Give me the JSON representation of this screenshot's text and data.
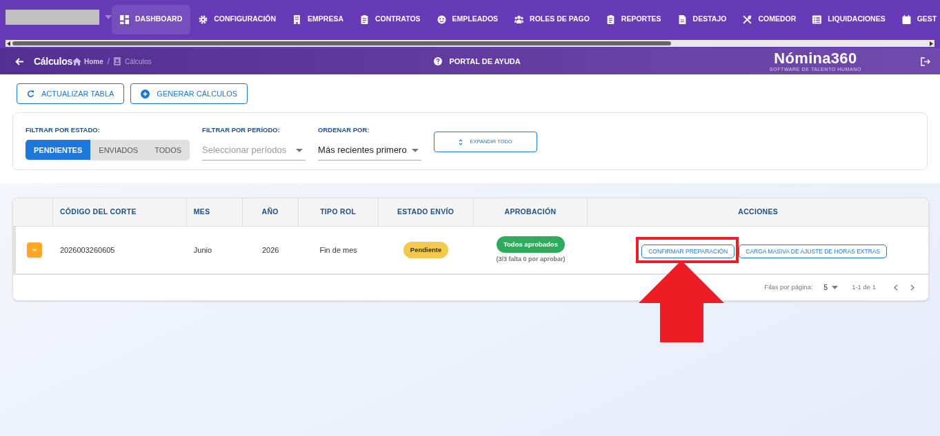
{
  "nav": {
    "items": [
      {
        "label": "DASHBOARD",
        "selected": true
      },
      {
        "label": "CONFIGURACIÓN",
        "selected": false
      },
      {
        "label": "EMPRESA",
        "selected": false
      },
      {
        "label": "CONTRATOS",
        "selected": false
      },
      {
        "label": "EMPLEADOS",
        "selected": false
      },
      {
        "label": "ROLES DE PAGO",
        "selected": false
      },
      {
        "label": "REPORTES",
        "selected": false
      },
      {
        "label": "DESTAJO",
        "selected": false
      },
      {
        "label": "COMEDOR",
        "selected": false
      },
      {
        "label": "LIQUIDACIONES",
        "selected": false
      },
      {
        "label": "GEST",
        "selected": false
      }
    ]
  },
  "header": {
    "title": "Cálculos",
    "breadcrumbs": [
      "Home",
      "Cálculos"
    ],
    "breadcrumb_separator": "/",
    "help": "PORTAL DE AYUDA",
    "logo": "Nómina360",
    "logo_tagline": "SOFTWARE DE TALENTO HUMANO"
  },
  "toolbar": {
    "buttons": [
      "ACTUALIZAR TABLA",
      "GENERAR CÁLCULOS"
    ]
  },
  "filters": {
    "state_label": "FILTRAR POR ESTADO:",
    "state_options": [
      {
        "label": "PENDIENTES",
        "selected": true
      },
      {
        "label": "ENVIADOS",
        "selected": false
      },
      {
        "label": "TODOS",
        "selected": false
      }
    ],
    "period_label": "FILTRAR POR PERÍODO:",
    "period_placeholder": "Seleccionar períodos",
    "order_label": "ORDENAR POR:",
    "order_value": "Más recientes primero",
    "expand_button": "EXPANDIR TODO"
  },
  "table": {
    "columns": [
      "CÓDIGO DEL CORTE",
      "MES",
      "AÑO",
      "TIPO ROL",
      "ESTADO ENVÍO",
      "APROBACIÓN",
      "ACCIONES"
    ],
    "rows": [
      {
        "code": "2026003260605",
        "month": "Junio",
        "year": "2026",
        "type": "Fin de mes",
        "status": "Pendiente",
        "approval": "Todos aprobados",
        "approval_note": "(3/3 falta 0 por aprobar)",
        "actions": [
          {
            "label": "CONFIRMAR PREPARACIÓN",
            "highlighted": true
          },
          {
            "label": "CARGA MASIVA DE AJUSTE DE HORAS EXTRAS",
            "highlighted": false
          }
        ]
      }
    ]
  },
  "pagination": {
    "rows_label": "Filas por página:",
    "rows_value": "5",
    "range": "1-1 de 1"
  }
}
